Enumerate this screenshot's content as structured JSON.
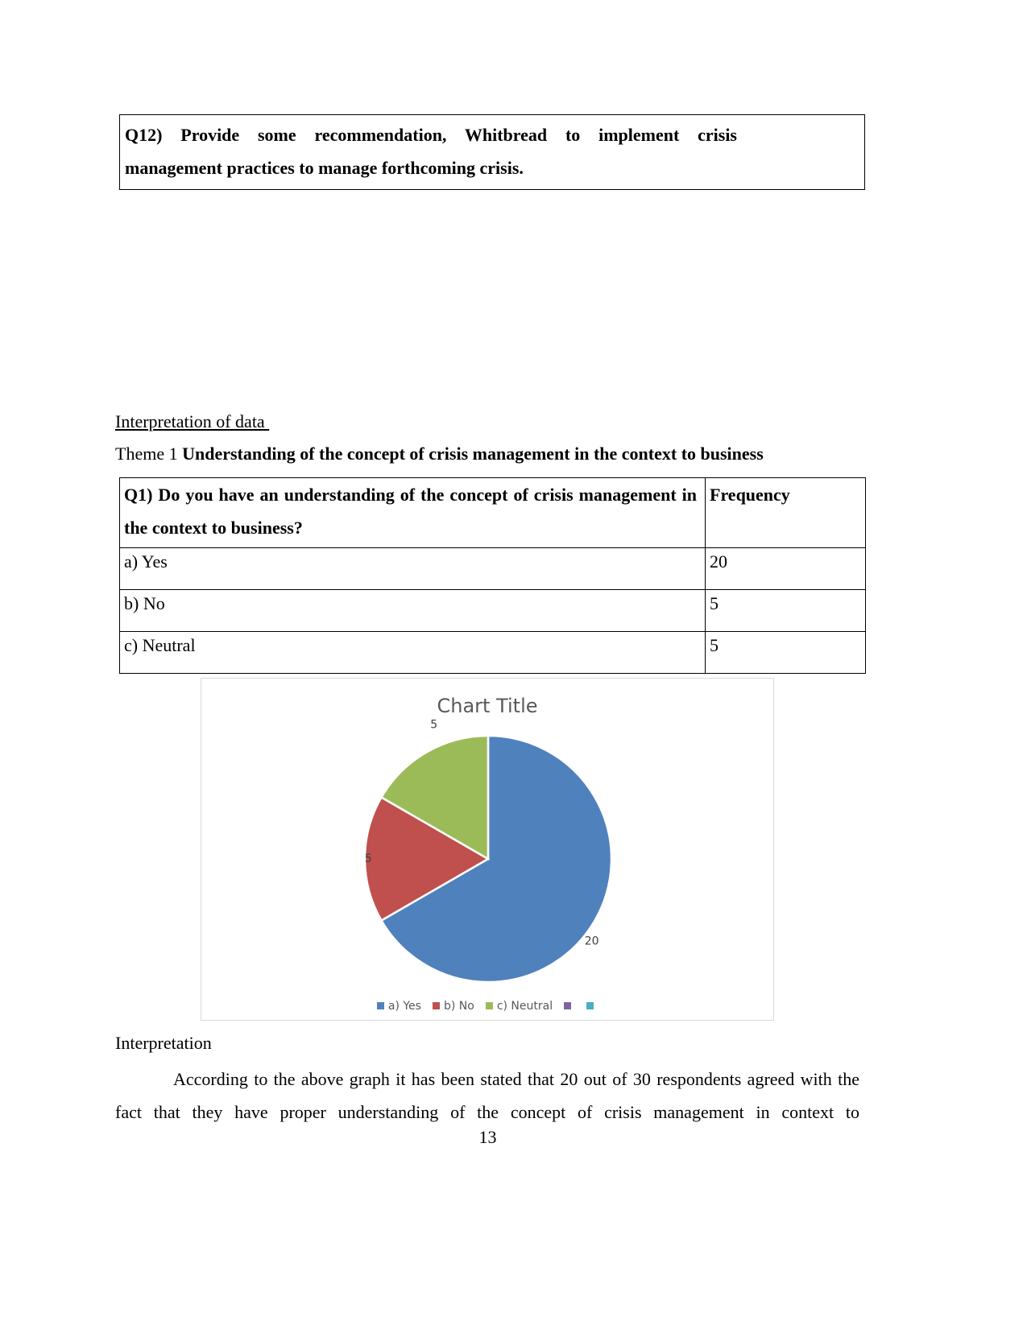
{
  "q12_box": {
    "text": "Q12) Provide some recommendation, Whitbread to implement crisis management practices  to manage forthcoming crisis."
  },
  "section_heading": "Interpretation of data ",
  "theme": {
    "prefix": "Theme 1 ",
    "title": "Understanding of the concept of crisis management in the context to business"
  },
  "frequency_table": {
    "question": "Q1) Do you have an understanding of the concept of crisis management in the context to business?",
    "column_header": "Frequency",
    "rows": [
      {
        "option": "a) Yes",
        "frequency": "20"
      },
      {
        "option": "b) No",
        "frequency": "5"
      },
      {
        "option": "c) Neutral",
        "frequency": "5"
      }
    ]
  },
  "chart_data": {
    "type": "pie",
    "title": "Chart Title",
    "categories": [
      "a) Yes",
      "b) No",
      "c) Neutral"
    ],
    "values": [
      20,
      5,
      5
    ],
    "colors": [
      "#4f81bd",
      "#c0504d",
      "#9bbb59"
    ],
    "data_labels": [
      "20",
      "5",
      "5"
    ],
    "legend_position": "bottom",
    "legend_entries": [
      {
        "label": "a) Yes",
        "color": "#4f81bd"
      },
      {
        "label": "b) No",
        "color": "#c0504d"
      },
      {
        "label": "c) Neutral",
        "color": "#9bbb59"
      },
      {
        "label": "",
        "color": "#8064a2"
      },
      {
        "label": "",
        "color": "#4bacc6"
      }
    ]
  },
  "interpretation": {
    "heading": "Interpretation",
    "paragraph": "According to the above graph it has been stated that 20 out of 30 respondents agreed with the fact that they have proper understanding of the concept of crisis management in context to"
  },
  "page_number": "13"
}
